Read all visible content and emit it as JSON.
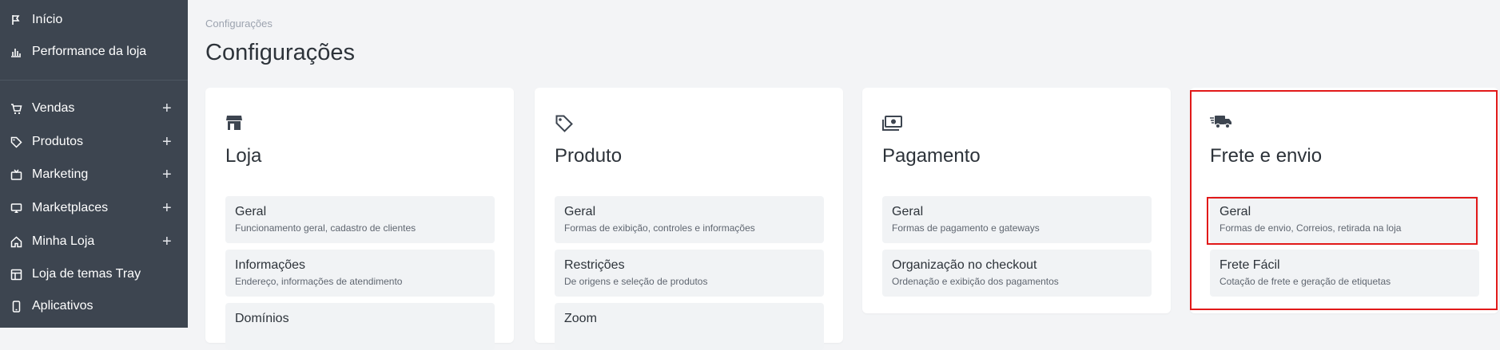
{
  "sidebar": {
    "items": [
      {
        "label": "Início",
        "icon": "flag-icon",
        "expandable": false
      },
      {
        "label": "Performance da loja",
        "icon": "bar-chart-icon",
        "expandable": false
      },
      {
        "label": "Vendas",
        "icon": "cart-icon",
        "expandable": true
      },
      {
        "label": "Produtos",
        "icon": "tag-icon",
        "expandable": true
      },
      {
        "label": "Marketing",
        "icon": "tv-icon",
        "expandable": true
      },
      {
        "label": "Marketplaces",
        "icon": "monitor-icon",
        "expandable": true
      },
      {
        "label": "Minha Loja",
        "icon": "home-icon",
        "expandable": true
      },
      {
        "label": "Loja de temas Tray",
        "icon": "layout-icon",
        "expandable": false
      },
      {
        "label": "Aplicativos",
        "icon": "phone-icon",
        "expandable": false
      }
    ],
    "expand_symbol": "+"
  },
  "breadcrumb": "Configurações",
  "page_title": "Configurações",
  "cards": [
    {
      "title": "Loja",
      "icon": "store-icon",
      "items": [
        {
          "title": "Geral",
          "subtitle": "Funcionamento geral, cadastro de clientes"
        },
        {
          "title": "Informações",
          "subtitle": "Endereço, informações de atendimento"
        },
        {
          "title": "Domínios",
          "subtitle": ""
        }
      ]
    },
    {
      "title": "Produto",
      "icon": "tag-icon",
      "items": [
        {
          "title": "Geral",
          "subtitle": "Formas de exibição, controles e informações"
        },
        {
          "title": "Restrições",
          "subtitle": "De origens e seleção de produtos"
        },
        {
          "title": "Zoom",
          "subtitle": ""
        }
      ]
    },
    {
      "title": "Pagamento",
      "icon": "money-icon",
      "items": [
        {
          "title": "Geral",
          "subtitle": "Formas de pagamento e gateways"
        },
        {
          "title": "Organização no checkout",
          "subtitle": "Ordenação e exibição dos pagamentos"
        }
      ]
    },
    {
      "title": "Frete e envio",
      "icon": "truck-icon",
      "items": [
        {
          "title": "Geral",
          "subtitle": "Formas de envio, Correios, retirada na loja"
        },
        {
          "title": "Frete Fácil",
          "subtitle": "Cotação de frete e geração de etiquetas"
        }
      ]
    }
  ],
  "colors": {
    "sidebar_bg": "#3d4550",
    "page_bg": "#f3f4f6",
    "highlight": "#e11919",
    "item_bg": "#f1f3f5"
  }
}
